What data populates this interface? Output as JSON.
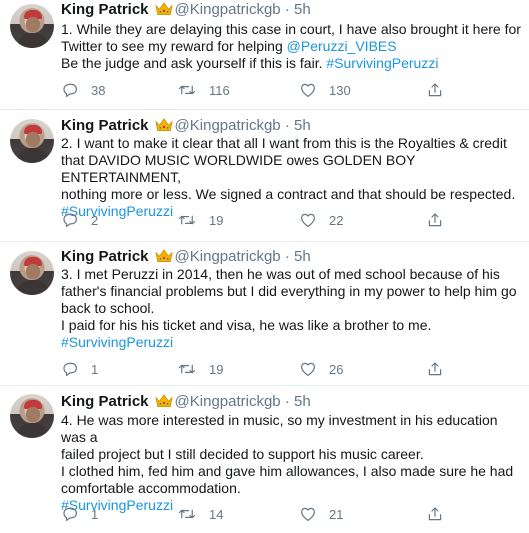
{
  "tweets": [
    {
      "name": "King Patrick",
      "handle": "@Kingpatrickgb",
      "dot": "·",
      "time": "5h",
      "lines": [
        [
          {
            "t": "1. While they are delaying this case in court, I have also brought it here for"
          }
        ],
        [
          {
            "t": "Twitter to see my reward for helping "
          },
          {
            "t": "@Peruzzi_VIBES",
            "link": true
          }
        ],
        [
          {
            "t": "Be the judge and ask yourself if this is fair. "
          },
          {
            "t": "#SurvivingPeruzzi",
            "link": true
          }
        ]
      ],
      "replies": "38",
      "retweets": "116",
      "likes": "130"
    },
    {
      "name": "King Patrick",
      "handle": "@Kingpatrickgb",
      "dot": "·",
      "time": "5h",
      "lines": [
        [
          {
            "t": "2. I want to make it clear that all I want from this is the Royalties & credit"
          }
        ],
        [
          {
            "t": "that DAVIDO MUSIC WORLDWIDE owes GOLDEN BOY ENTERTAINMENT,"
          }
        ],
        [
          {
            "t": "nothing more or less. We signed a contract and that should be respected."
          }
        ],
        [
          {
            "t": "#SurvivingPeruzzi",
            "link": true
          }
        ]
      ],
      "replies": "2",
      "retweets": "19",
      "likes": "22"
    },
    {
      "name": "King Patrick",
      "handle": "@Kingpatrickgb",
      "dot": "·",
      "time": "5h",
      "lines": [
        [
          {
            "t": "3. I met Peruzzi in 2014, then he was out of med school because of his"
          }
        ],
        [
          {
            "t": "father's financial problems but I did everything in my power to help him go"
          }
        ],
        [
          {
            "t": "back to school."
          }
        ],
        [
          {
            "t": "I paid for his his ticket and visa, he was like a brother to me."
          }
        ],
        [
          {
            "t": "#SurvivingPeruzzi",
            "link": true
          }
        ]
      ],
      "replies": "1",
      "retweets": "19",
      "likes": "26"
    },
    {
      "name": "King Patrick",
      "handle": "@Kingpatrickgb",
      "dot": "·",
      "time": "5h",
      "lines": [
        [
          {
            "t": "4. He was more interested in music, so my investment in his education was a"
          }
        ],
        [
          {
            "t": "failed project but I still decided to support his music career."
          }
        ],
        [
          {
            "t": "I clothed him, fed him and gave him allowances, I also made sure he had"
          }
        ],
        [
          {
            "t": "comfortable accommodation."
          }
        ],
        [
          {
            "t": "#SurvivingPeruzzi",
            "link": true
          }
        ]
      ],
      "replies": "1",
      "retweets": "14",
      "likes": "21"
    }
  ],
  "icons": {
    "avatar": "profile-avatar",
    "badge": "crown-emoji-icon",
    "reply": "reply-icon",
    "retweet": "retweet-icon",
    "like": "heart-icon",
    "share": "share-icon"
  },
  "colors": {
    "link": "#1b95e0",
    "muted": "#657786",
    "text": "#14171a",
    "divider": "#e6ecf0",
    "crown": "#f4b400"
  }
}
